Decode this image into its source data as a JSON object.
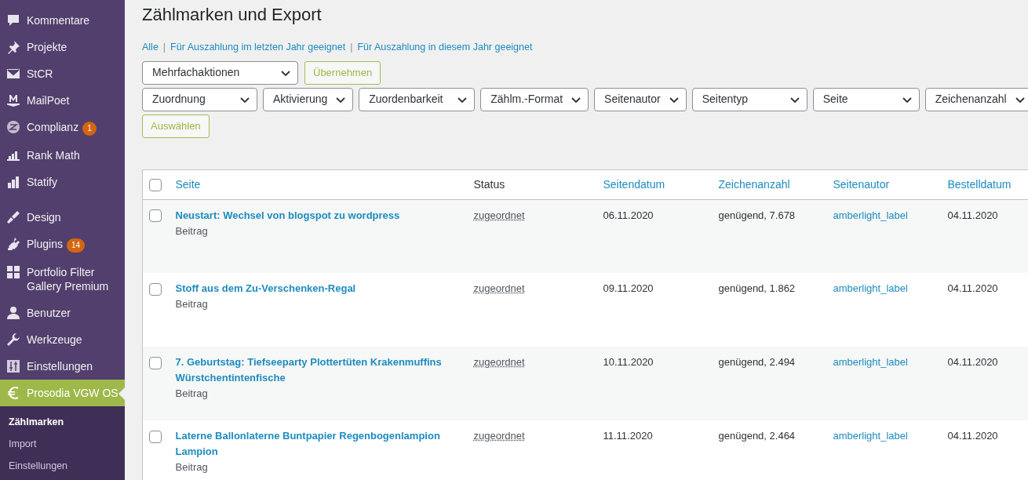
{
  "sidebar": {
    "groups": [
      [
        {
          "label": "Kommentare",
          "selected": false
        },
        {
          "label": "Projekte",
          "selected": false
        },
        {
          "label": "StCR",
          "selected": false
        },
        {
          "label": "MailPoet",
          "selected": false
        },
        {
          "label": "Complianz",
          "badge": "1",
          "selected": false
        },
        {
          "label": "Rank Math",
          "selected": false
        },
        {
          "label": "Statify",
          "selected": false
        }
      ],
      [
        {
          "label": "Design",
          "selected": false
        },
        {
          "label": "Plugins",
          "badge": "14",
          "selected": false
        },
        {
          "label": "Portfolio Filter Gallery Premium",
          "selected": false
        },
        {
          "label": "Benutzer",
          "selected": false
        },
        {
          "label": "Werkzeuge",
          "selected": false
        },
        {
          "label": "Einstellungen",
          "selected": false
        },
        {
          "label": "Prosodia VGW OS",
          "selected": true
        }
      ]
    ],
    "submenu": [
      {
        "label": "Zählmarken",
        "selected": true
      },
      {
        "label": "Import",
        "selected": false
      },
      {
        "label": "Einstellungen",
        "selected": false
      }
    ]
  },
  "title": "Zählmarken und Export",
  "views": [
    {
      "label": "Alle",
      "selected": false
    },
    {
      "separator": "|",
      "label": "Für Auszahlung im letzten Jahr geeignet",
      "selected": false
    },
    {
      "separator": "|",
      "label": "Für Auszahlung in diesem Jahr geeignet",
      "selected": false
    }
  ],
  "bulk_actions": {
    "value": "Mehrfachaktionen",
    "button": "Übernehmen"
  },
  "filters": {
    "selects": [
      "Zuordnung",
      "Aktivierung",
      "Zuordenbarkeit",
      "Zählm.-Format",
      "Seitenautor",
      "Seitentyp",
      "Seite",
      "Zeichenanzahl"
    ],
    "button": "Auswählen"
  },
  "table": {
    "select_all_checked": false,
    "columns": [
      {
        "label": "Seite",
        "sortable": true
      },
      {
        "label": "Status",
        "sortable": false
      },
      {
        "label": "Seitendatum",
        "sortable": true
      },
      {
        "label": "Zeichenanzahl",
        "sortable": true
      },
      {
        "label": "Seitenautor",
        "sortable": true
      },
      {
        "label": "Bestelldatum",
        "sortable": true
      }
    ],
    "rows": [
      {
        "checked": false,
        "title": "Neustart: Wechsel von blogspot zu wordpress",
        "type": "Beitrag",
        "status": "zugeordnet",
        "date": "06.11.2020",
        "chars": "genügend, 7.678",
        "author": "amberlight_label",
        "order_date": "04.11.2020"
      },
      {
        "checked": false,
        "title": "Stoff aus dem Zu-Verschenken-Regal",
        "type": "Beitrag",
        "status": "zugeordnet",
        "date": "09.11.2020",
        "chars": "genügend, 1.862",
        "author": "amberlight_label",
        "order_date": "04.11.2020"
      },
      {
        "checked": false,
        "title": "7. Geburtstag: Tiefseeparty Plottertüten Krakenmuffins Würstchentintenfische",
        "type": "Beitrag",
        "status": "zugeordnet",
        "date": "10.11.2020",
        "chars": "genügend, 2.494",
        "author": "amberlight_label",
        "order_date": "04.11.2020"
      },
      {
        "checked": false,
        "title": "Laterne Ballonlaterne Buntpapier Regenbogenlampion Lampion",
        "type": "Beitrag",
        "status": "zugeordnet",
        "date": "11.11.2020",
        "chars": "genügend, 2.464",
        "author": "amberlight_label",
        "order_date": "04.11.2020"
      }
    ]
  }
}
